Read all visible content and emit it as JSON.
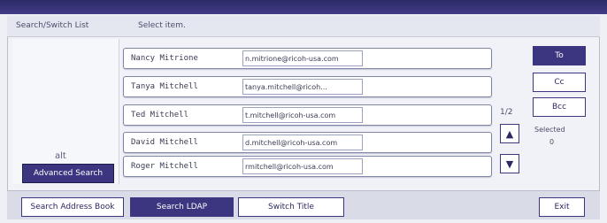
{
  "header": {
    "title": "Search/Switch List",
    "subtitle": "Select item."
  },
  "left_panel": {
    "alt_label": "alt",
    "advanced_search_label": "Advanced Search"
  },
  "results": [
    {
      "name": "Nancy Mitrione",
      "email": "n.mitrione@ricoh-usa.com"
    },
    {
      "name": "Tanya Mitchell",
      "email": "tanya.mitchell@ricoh..."
    },
    {
      "name": "Ted Mitchell",
      "email": "t.mitchell@ricoh-usa.com"
    },
    {
      "name": "David Mitchell",
      "email": "d.mitchell@ricoh-usa.com"
    },
    {
      "name": "Roger Mitchell",
      "email": "rmitchell@ricoh-usa.com"
    }
  ],
  "pager": {
    "label": "1/2",
    "up_icon": "▲",
    "down_icon": "▼"
  },
  "side_buttons": {
    "to_label": "To",
    "cc_label": "Cc",
    "bcc_label": "Bcc",
    "selected_label": "Selected",
    "selected_count": "0"
  },
  "bottom_tabs": {
    "search_address_book": "Search Address Book",
    "search_ldap": "Search LDAP",
    "switch_title": "Switch Title"
  },
  "exit_label": "Exit",
  "colors": {
    "accent": "#3b367f",
    "topbar": "#2c2a66"
  }
}
